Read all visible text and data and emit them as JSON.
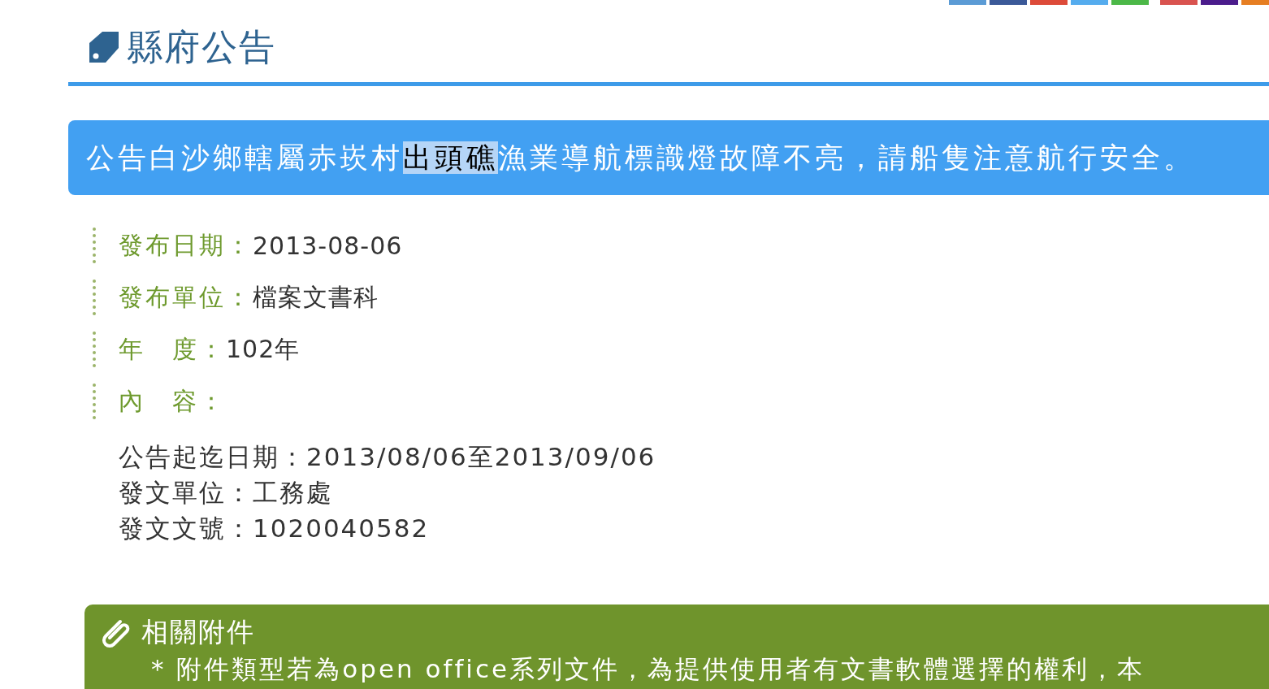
{
  "share_buttons": [
    {
      "color": "#5b9bd5"
    },
    {
      "color": "#3b5998"
    },
    {
      "color": "#dd4b39"
    },
    {
      "color": "#55acee"
    },
    {
      "color": "#4cb848"
    },
    {
      "color": "#d9534f"
    },
    {
      "color": "#4b1c8c"
    },
    {
      "color": "#e67e22"
    }
  ],
  "page_title": "縣府公告",
  "headline": [
    {
      "text": "公告白沙鄉轄屬赤崁村",
      "selected": false
    },
    {
      "text": "出頭礁",
      "selected": true
    },
    {
      "text": "漁業導航標識燈故障不亮，請船隻注意航行安全。",
      "selected": false
    }
  ],
  "fields": [
    {
      "label": "發布日期：",
      "value": "2013-08-06"
    },
    {
      "label": "發布單位：",
      "value": "檔案文書科"
    },
    {
      "label": "年　度：",
      "value": "102年"
    },
    {
      "label": "內　容："
    }
  ],
  "content_lines": [
    "公告起迄日期：2013/08/06至2013/09/06",
    "發文單位：工務處",
    "發文文號：1020040582"
  ],
  "attachments": {
    "title": "相關附件",
    "note": "* 附件類型若為open office系列文件，為提供使用者有文書軟體選擇的權利，本"
  }
}
